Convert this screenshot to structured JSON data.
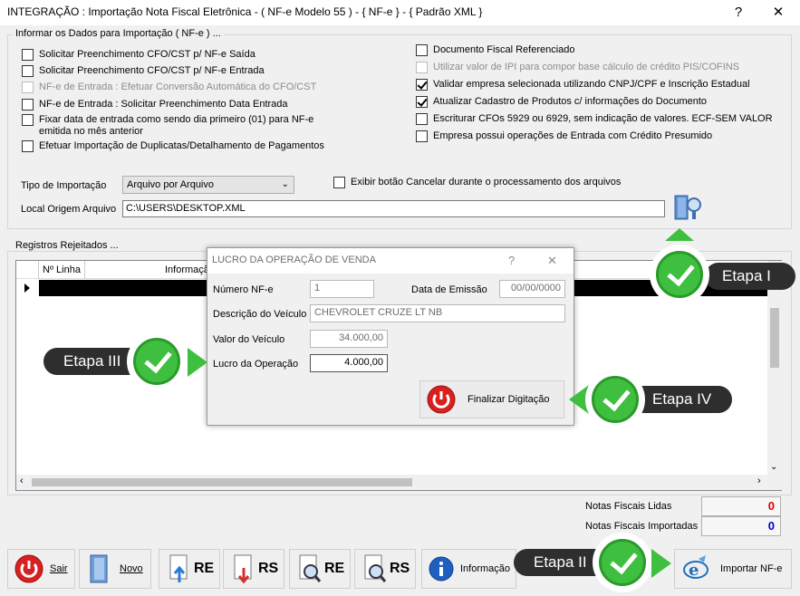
{
  "window": {
    "title": "INTEGRAÇÃO : Importação Nota Fiscal Eletrônica - ( NF-e Modelo 55 ) - { NF-e } - { Padrão XML }"
  },
  "group_dados": {
    "label": "Informar os Dados para Importação ( NF-e ) ...",
    "left_options": [
      {
        "label": "Solicitar Preenchimento CFO/CST p/ NF-e Saída",
        "checked": false,
        "disabled": false
      },
      {
        "label": "Solicitar Preenchimento CFO/CST p/ NF-e Entrada",
        "checked": false,
        "disabled": false
      },
      {
        "label": "NF-e de Entrada : Efetuar Conversão Automática do CFO/CST",
        "checked": false,
        "disabled": true
      },
      {
        "label": "NF-e de Entrada : Solicitar Preenchimento Data Entrada",
        "checked": false,
        "disabled": false
      },
      {
        "label": "Fixar data de entrada como sendo dia primeiro (01) para NF-e emitida no mês anterior",
        "checked": false,
        "disabled": false
      },
      {
        "label": "Efetuar Importação de Duplicatas/Detalhamento de Pagamentos",
        "checked": false,
        "disabled": false
      }
    ],
    "right_options": [
      {
        "label": "Documento Fiscal Referenciado",
        "checked": false,
        "disabled": false
      },
      {
        "label": "Utilizar valor de IPI para compor base cálculo de crédito PIS/COFINS",
        "checked": false,
        "disabled": true
      },
      {
        "label": "Validar empresa selecionada utilizando CNPJ/CPF e Inscrição Estadual",
        "checked": true,
        "disabled": false
      },
      {
        "label": "Atualizar Cadastro de Produtos c/ informações do Documento",
        "checked": true,
        "disabled": false
      },
      {
        "label": "Escriturar CFOs 5929 ou 6929, sem indicação de valores. ECF-SEM VALOR",
        "checked": false,
        "disabled": false
      },
      {
        "label": "Empresa possui operações de Entrada com Crédito Presumido",
        "checked": false,
        "disabled": false
      }
    ],
    "tipo_importacao_label": "Tipo de Importação",
    "tipo_importacao_value": "Arquivo por Arquivo",
    "exibir_cancelar_label": "Exibir botão Cancelar durante o processamento dos arquivos",
    "local_origem_label": "Local Origem Arquivo",
    "local_origem_value": "C:\\USERS\\DESKTOP.XML"
  },
  "registros": {
    "label": "Registros Rejeitados ...",
    "columns": [
      "Nº Linha",
      "Informação"
    ]
  },
  "dialog": {
    "title": "LUCRO DA OPERAÇÃO DE VENDA",
    "help": "?",
    "close": "✕",
    "numero_nfe_label": "Número NF-e",
    "numero_nfe_value": "1",
    "data_emissao_label": "Data de Emissão",
    "data_emissao_value": "00/00/0000",
    "descricao_label": "Descrição do Veículo",
    "descricao_value": "CHEVROLET CRUZE LT NB",
    "valor_veiculo_label": "Valor do Veículo",
    "valor_veiculo_value": "34.000,00",
    "lucro_label": "Lucro da Operação",
    "lucro_value": "4.000,00",
    "finalizar_label": "Finalizar Digitação"
  },
  "callouts": {
    "etapa_1": "Etapa I",
    "etapa_2": "Etapa II",
    "etapa_3": "Etapa III",
    "etapa_4": "Etapa IV"
  },
  "counters": {
    "lidas_label": "Notas Fiscais Lidas",
    "lidas_value": "0",
    "importadas_label": "Notas Fiscais Importadas",
    "importadas_value": "0",
    "lidas_color": "#e00000",
    "importadas_color": "#0000d0"
  },
  "toolbar": {
    "sair": "Sair",
    "novo": "Novo",
    "re": "RE",
    "rs": "RS",
    "informacao": "Informação",
    "importar": "Importar NF-e"
  },
  "colors": {
    "accent_green": "#3fbf3f",
    "callout_bg": "#2e2e2e"
  }
}
